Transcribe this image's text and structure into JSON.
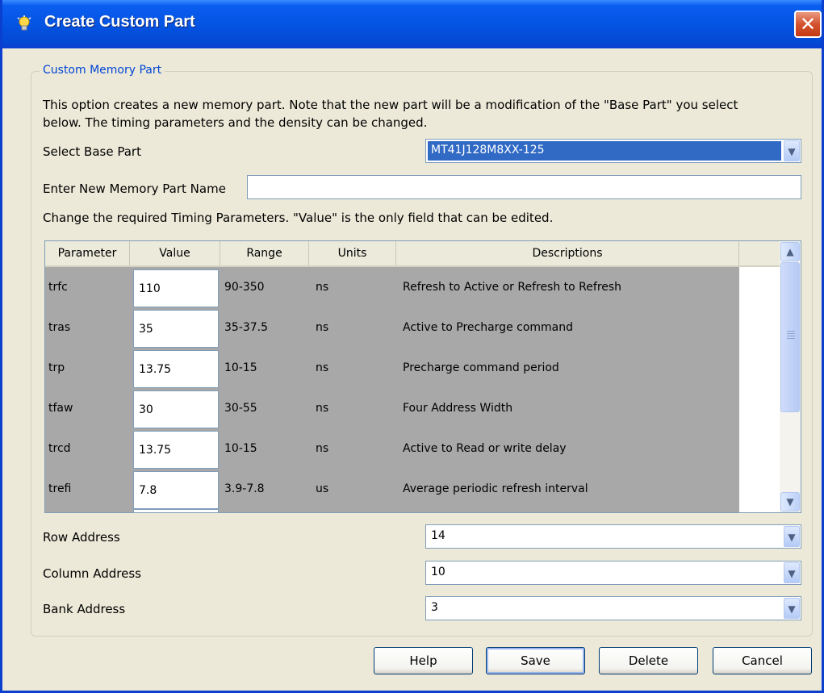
{
  "window": {
    "title": "Create Custom Part",
    "close_label": "✕"
  },
  "group": {
    "title": "Custom Memory Part"
  },
  "intro": {
    "line1": "This option creates a new memory part. Note that the new part will be a modification of the \"Base Part\" you select",
    "line2": "below. The timing parameters and the density can be changed."
  },
  "base_part": {
    "label": "Select Base Part",
    "value": "MT41J128M8XX-125"
  },
  "new_name": {
    "label": "Enter New Memory Part Name",
    "value": ""
  },
  "timing_note": "Change the required Timing Parameters. \"Value\" is the only field that can be edited.",
  "table": {
    "headers": [
      "Parameter",
      "Value",
      "Range",
      "Units",
      "Descriptions"
    ],
    "rows": [
      {
        "parameter": "trfc",
        "value": "110",
        "range": "90-350",
        "units": "ns",
        "description": "Refresh to Active or Refresh to Refresh"
      },
      {
        "parameter": "tras",
        "value": "35",
        "range": "35-37.5",
        "units": "ns",
        "description": "Active to Precharge command"
      },
      {
        "parameter": "trp",
        "value": "13.75",
        "range": "10-15",
        "units": "ns",
        "description": "Precharge command period"
      },
      {
        "parameter": "tfaw",
        "value": "30",
        "range": "30-55",
        "units": "ns",
        "description": "Four Address Width"
      },
      {
        "parameter": "trcd",
        "value": "13.75",
        "range": "10-15",
        "units": "ns",
        "description": "Active to Read or write delay"
      },
      {
        "parameter": "trefi",
        "value": "7.8",
        "range": "3.9-7.8",
        "units": "us",
        "description": "Average periodic refresh interval"
      }
    ]
  },
  "row_address": {
    "label": "Row Address",
    "value": "14"
  },
  "column_address": {
    "label": "Column Address",
    "value": "10"
  },
  "bank_address": {
    "label": "Bank Address",
    "value": "3"
  },
  "buttons": {
    "help": "Help",
    "save": "Save",
    "delete": "Delete",
    "cancel": "Cancel"
  },
  "icons": {
    "title": "lightbulb-icon",
    "dropdown": "chevron-down-icon",
    "scroll_up": "arrow-up-icon",
    "scroll_down": "arrow-down-icon"
  },
  "colors": {
    "titlebar": "#0554e3",
    "selection": "#316ac5",
    "group_title": "#0046d5",
    "close": "#d4532e"
  }
}
